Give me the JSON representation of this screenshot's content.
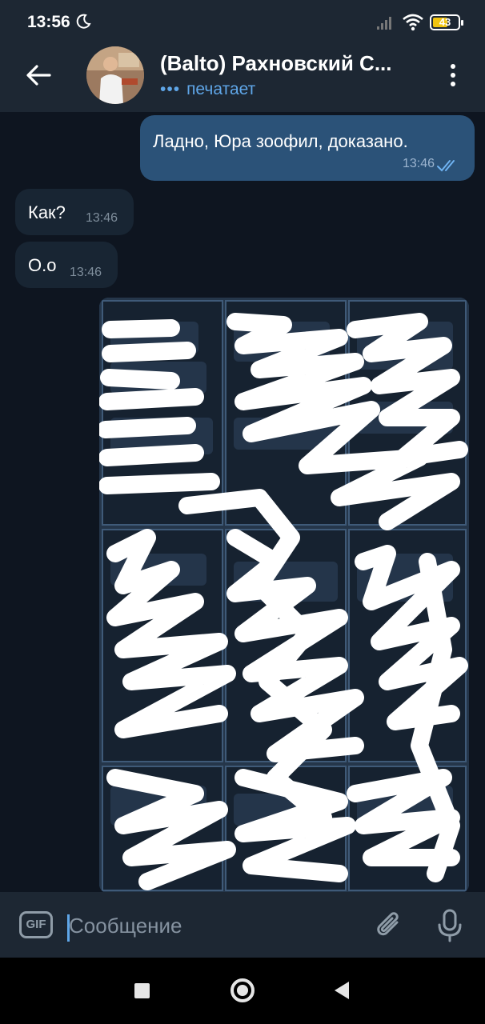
{
  "status_bar": {
    "time": "13:56",
    "battery": "43"
  },
  "header": {
    "title": "(Balto) Рахновский С...",
    "status": "печатает",
    "typing_dots": "•••"
  },
  "messages": [
    {
      "direction": "out",
      "text": "Ладно, Юра зоофил, доказано.",
      "time": "13:46",
      "read": true
    },
    {
      "direction": "in",
      "text": "Как?",
      "time": "13:46"
    },
    {
      "direction": "in",
      "text": "О.о",
      "time": "13:46"
    },
    {
      "direction": "out",
      "type": "photo",
      "description_visible": false
    }
  ],
  "input": {
    "gif_label": "GIF",
    "placeholder": "Сообщение"
  },
  "colors": {
    "header_bg": "#1d2733",
    "chat_bg": "#0e1520",
    "outgoing_bubble": "#2b5278",
    "incoming_bubble": "#182533",
    "accent": "#5fa6e8"
  },
  "icons": {
    "back": "arrow-left-icon",
    "more": "more-vertical-icon",
    "attach": "paperclip-icon",
    "mic": "microphone-icon",
    "read_receipt": "double-check-icon"
  }
}
